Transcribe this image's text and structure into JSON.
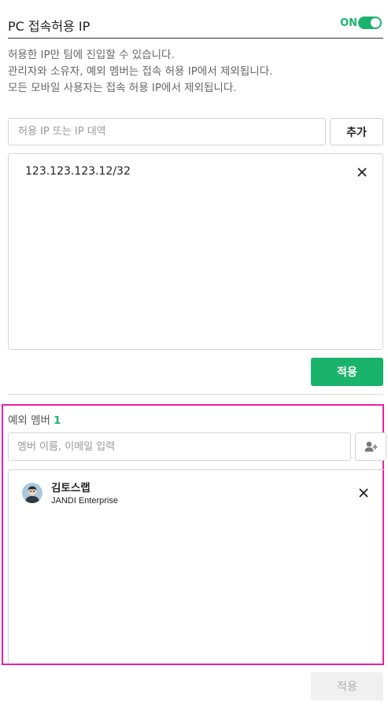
{
  "header": {
    "title": "PC 접속허용 IP",
    "toggle_label": "ON",
    "toggle_state": "on",
    "accent_color": "#1ab36b"
  },
  "description": [
    "허용한 IP만 팀에 진입할 수 있습니다.",
    "관리자와 소유자, 예외 멤버는 접속 허용 IP에서 제외됩니다.",
    "모든 모바일 사용자는 접속 허용 IP에서 제외됩니다."
  ],
  "ip_form": {
    "placeholder": "허용 IP 또는 IP 대역",
    "value": "",
    "add_label": "추가"
  },
  "ip_list": [
    {
      "address": "123.123.123.12/32",
      "remove_icon": "close-icon"
    }
  ],
  "apply_ip_label": "적용",
  "exceptions": {
    "title": "예외 멤버",
    "count": "1",
    "search_placeholder": "멤버 이름, 이메일 입력",
    "add_icon": "add-user-icon",
    "members": [
      {
        "name": "김토스랩",
        "org": "JANDI Enterprise",
        "avatar_icon": "avatar"
      }
    ],
    "highlight_color": "#e81fa6"
  },
  "apply_members_label": "적용"
}
